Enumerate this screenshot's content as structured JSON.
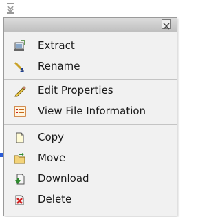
{
  "menu": {
    "items": [
      {
        "label": "Extract",
        "icon": "extract-icon"
      },
      {
        "label": "Rename",
        "icon": "rename-icon"
      },
      {
        "label": "Edit Properties",
        "icon": "pencil-icon"
      },
      {
        "label": "View File Information",
        "icon": "file-info-icon"
      },
      {
        "label": "Copy",
        "icon": "copy-icon"
      },
      {
        "label": "Move",
        "icon": "move-folder-icon"
      },
      {
        "label": "Download",
        "icon": "download-icon"
      },
      {
        "label": "Delete",
        "icon": "delete-icon"
      }
    ]
  }
}
